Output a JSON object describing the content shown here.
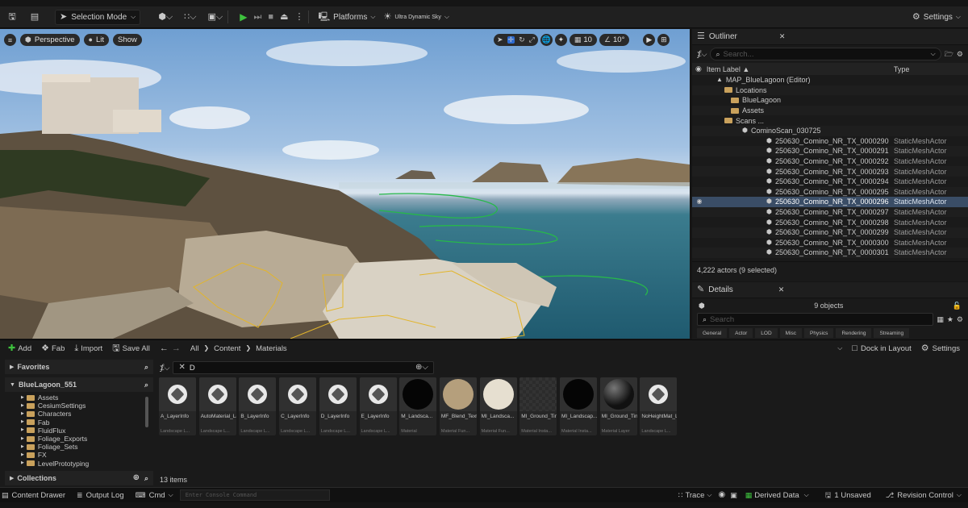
{
  "toolbar": {
    "mode_label": "Selection Mode",
    "platforms_label": "Platforms",
    "sky_label": "Ultra Dynamic Sky",
    "settings_label": "Settings"
  },
  "viewport": {
    "perspective_label": "Perspective",
    "lit_label": "Lit",
    "show_label": "Show",
    "grid_value": "10",
    "angle_value": "10°"
  },
  "outliner": {
    "tab_label": "Outliner",
    "search_placeholder": "Search...",
    "col_label": "Item Label ▲",
    "col_type": "Type",
    "tree": [
      {
        "label": "MAP_BlueLagoon (Editor)",
        "type": "",
        "indent": 28,
        "icon": "map-icon"
      },
      {
        "label": "Locations",
        "type": "",
        "indent": 38,
        "icon": "folder-icon"
      },
      {
        "label": "BlueLagoon",
        "type": "",
        "indent": 46,
        "icon": "folder-icon"
      },
      {
        "label": "Assets",
        "type": "",
        "indent": 46,
        "icon": "folder-icon"
      },
      {
        "label": "Scans ...",
        "type": "",
        "indent": 38,
        "icon": "folder-icon"
      },
      {
        "label": "CominoScan_030725",
        "type": "",
        "indent": 60,
        "icon": "actor-icon"
      },
      {
        "label": "250630_Comino_NR_TX_0000290",
        "type": "StaticMeshActor",
        "indent": 90,
        "icon": "mesh-icon"
      },
      {
        "label": "250630_Comino_NR_TX_0000291",
        "type": "StaticMeshActor",
        "indent": 90,
        "icon": "mesh-icon"
      },
      {
        "label": "250630_Comino_NR_TX_0000292",
        "type": "StaticMeshActor",
        "indent": 90,
        "icon": "mesh-icon"
      },
      {
        "label": "250630_Comino_NR_TX_0000293",
        "type": "StaticMeshActor",
        "indent": 90,
        "icon": "mesh-icon"
      },
      {
        "label": "250630_Comino_NR_TX_0000294",
        "type": "StaticMeshActor",
        "indent": 90,
        "icon": "mesh-icon"
      },
      {
        "label": "250630_Comino_NR_TX_0000295",
        "type": "StaticMeshActor",
        "indent": 90,
        "icon": "mesh-icon"
      },
      {
        "label": "250630_Comino_NR_TX_0000296",
        "type": "StaticMeshActor",
        "indent": 90,
        "icon": "mesh-icon",
        "selected": true
      },
      {
        "label": "250630_Comino_NR_TX_0000297",
        "type": "StaticMeshActor",
        "indent": 90,
        "icon": "mesh-icon"
      },
      {
        "label": "250630_Comino_NR_TX_0000298",
        "type": "StaticMeshActor",
        "indent": 90,
        "icon": "mesh-icon"
      },
      {
        "label": "250630_Comino_NR_TX_0000299",
        "type": "StaticMeshActor",
        "indent": 90,
        "icon": "mesh-icon"
      },
      {
        "label": "250630_Comino_NR_TX_0000300",
        "type": "StaticMeshActor",
        "indent": 90,
        "icon": "mesh-icon"
      },
      {
        "label": "250630_Comino_NR_TX_0000301",
        "type": "StaticMeshActor",
        "indent": 90,
        "icon": "mesh-icon"
      }
    ],
    "actor_count": "4,222 actors (9 selected)"
  },
  "details": {
    "tab_label": "Details",
    "objects_count": "9 objects",
    "search_placeholder": "Search",
    "tabs": [
      "General",
      "Actor",
      "LOD",
      "Misc",
      "Physics",
      "Rendering",
      "Streaming"
    ]
  },
  "content": {
    "add_label": "Add",
    "fab_label": "Fab",
    "import_label": "Import",
    "save_all_label": "Save All",
    "path": [
      "All",
      "Content",
      "Materials"
    ],
    "dock_label": "Dock in Layout",
    "settings_label": "Settings",
    "favorites_label": "Favorites",
    "root_label": "BlueLagoon_551",
    "folders": [
      "Assets",
      "CesiumSettings",
      "Characters",
      "Fab",
      "FluidFlux",
      "Foliage_Exports",
      "Foliage_Sets",
      "FX",
      "LevelPrototyping"
    ],
    "collections_label": "Collections",
    "filter_text": "D",
    "items_count": "13 items",
    "assets": [
      {
        "name": "A_LayerInfo",
        "type": "Landscape L...",
        "thumb": "cube"
      },
      {
        "name": "AutoMaterial_LayerInfo",
        "type": "Landscape L...",
        "thumb": "cube"
      },
      {
        "name": "B_LayerInfo",
        "type": "Landscape L...",
        "thumb": "cube"
      },
      {
        "name": "C_LayerInfo",
        "type": "Landscape L...",
        "thumb": "cube"
      },
      {
        "name": "D_LayerInfo",
        "type": "Landscape L...",
        "thumb": "cube"
      },
      {
        "name": "E_LayerInfo",
        "type": "Landscape L...",
        "thumb": "cube"
      },
      {
        "name": "M_Landsca...",
        "type": "Material",
        "thumb": "black"
      },
      {
        "name": "MF_Blend_Texture",
        "type": "Material Fun...",
        "thumb": "tan"
      },
      {
        "name": "MI_Landsca...",
        "type": "Material Fun...",
        "thumb": "cream"
      },
      {
        "name": "MI_Ground_Tint",
        "type": "Material Insta...",
        "thumb": "check"
      },
      {
        "name": "MI_Landscap...",
        "type": "Material Insta...",
        "thumb": "black"
      },
      {
        "name": "MI_Ground_Tint",
        "type": "Material Layer",
        "thumb": "dark"
      },
      {
        "name": "NoHeightMat_LayerInfo",
        "type": "Landscape L...",
        "thumb": "cube"
      }
    ]
  },
  "statusbar": {
    "content_drawer": "Content Drawer",
    "output_log": "Output Log",
    "cmd": "Cmd",
    "console_placeholder": "Enter Console Command",
    "trace": "Trace",
    "derived_data": "Derived Data",
    "unsaved": "1 Unsaved",
    "revision": "Revision Control"
  }
}
